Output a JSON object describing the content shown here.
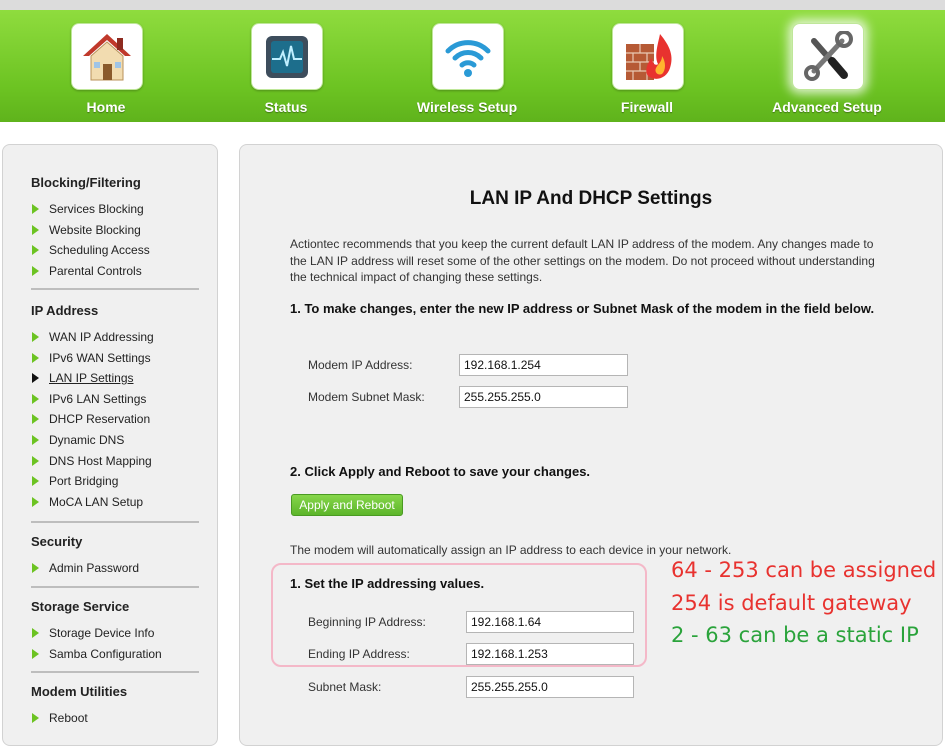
{
  "nav": {
    "items": [
      {
        "label": "Home",
        "icon": "house-icon"
      },
      {
        "label": "Status",
        "icon": "monitor-icon"
      },
      {
        "label": "Wireless Setup",
        "icon": "wifi-icon"
      },
      {
        "label": "Firewall",
        "icon": "firewall-icon"
      },
      {
        "label": "Advanced Setup",
        "icon": "tools-icon",
        "active": true
      }
    ]
  },
  "sidebar": {
    "sections": [
      {
        "title": "Blocking/Filtering",
        "items": [
          "Services Blocking",
          "Website Blocking",
          "Scheduling Access",
          "Parental Controls"
        ]
      },
      {
        "title": "IP Address",
        "items": [
          "WAN IP Addressing",
          "IPv6 WAN Settings",
          "LAN IP Settings",
          "IPv6 LAN Settings",
          "DHCP Reservation",
          "Dynamic DNS",
          "DNS Host Mapping",
          "Port Bridging",
          "MoCA LAN Setup"
        ],
        "current": "LAN IP Settings"
      },
      {
        "title": "Security",
        "items": [
          "Admin Password"
        ]
      },
      {
        "title": "Storage Service",
        "items": [
          "Storage Device Info",
          "Samba Configuration"
        ]
      },
      {
        "title": "Modem Utilities",
        "items": [
          "Reboot"
        ]
      }
    ]
  },
  "main": {
    "title": "LAN IP And DHCP Settings",
    "intro": "Actiontec recommends that you keep the current default LAN IP address of the modem. Any changes made to the LAN IP address will reset some of the other settings on the modem. Do not proceed without understanding the technical impact of changing these settings.",
    "step1": "1. To make changes, enter the new IP address or Subnet Mask of the modem in the field below.",
    "modem_ip_label": "Modem IP Address:",
    "modem_ip_value": "192.168.1.254",
    "modem_mask_label": "Modem Subnet Mask:",
    "modem_mask_value": "255.255.255.0",
    "step2": "2. Click Apply and Reboot to save your changes.",
    "apply_button": "Apply and Reboot",
    "dhcp_note": "The modem will automatically assign an IP address to each device in your network.",
    "dhcp_step": "1. Set the IP addressing values.",
    "begin_label": "Beginning IP Address:",
    "begin_value": "192.168.1.64",
    "end_label": "Ending IP Address:",
    "end_value": "192.168.1.253",
    "subnet_label": "Subnet Mask:",
    "subnet_value": "255.255.255.0"
  },
  "annotations": [
    {
      "text": "64 - 253 can be assigned",
      "color": "#e8322f"
    },
    {
      "text": "254 is default gateway",
      "color": "#e8322f"
    },
    {
      "text": "2 - 63 can be a static IP",
      "color": "#2aa33b"
    }
  ],
  "colors": {
    "accent_green": "#6cc322",
    "annotation_red": "#e8322f",
    "annotation_green": "#2aa33b",
    "highlight_pink": "#f4b8c8"
  }
}
